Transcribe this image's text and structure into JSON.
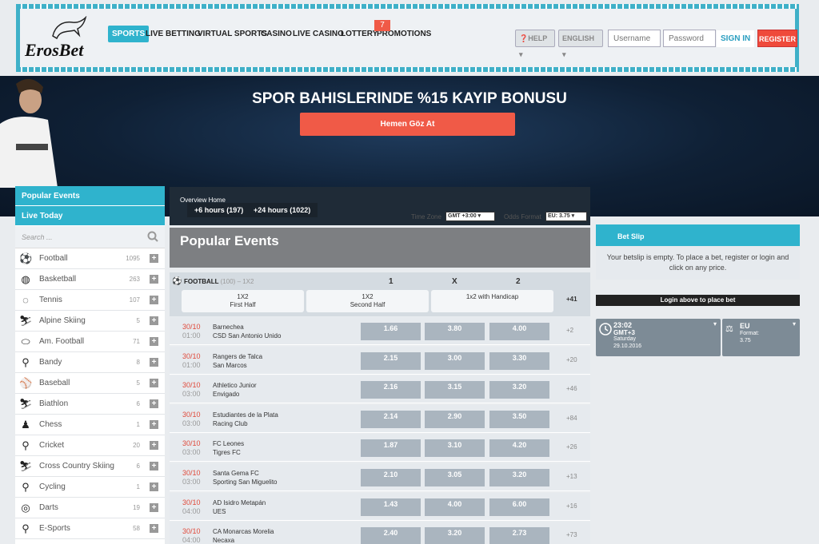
{
  "brand": {
    "name": "ErosBet"
  },
  "nav": [
    {
      "label": "SPORTS"
    },
    {
      "label": "LIVE BETTING"
    },
    {
      "label": "VIRTUAL SPORTS"
    },
    {
      "label": "CASINO"
    },
    {
      "label": "LIVE CASINO"
    },
    {
      "label": "LOTTERY"
    },
    {
      "label": "PROMOTIONS"
    }
  ],
  "promo_badge": "7",
  "header": {
    "help": "HELP",
    "language": "ENGLISH",
    "username_placeholder": "Username",
    "password_placeholder": "Password",
    "signin": "SIGN IN",
    "register": "REGISTER"
  },
  "hero": {
    "title": "SPOR BAHISLERINDE %15 KAYIP BONUSU",
    "button": "Hemen Göz At"
  },
  "left": {
    "popular": "Popular Events",
    "live_today": "Live Today",
    "search_placeholder": "Search ...",
    "sports": [
      {
        "name": "Football",
        "count": "1095",
        "icon": "soccer-ball-icon"
      },
      {
        "name": "Basketball",
        "count": "263",
        "icon": "basketball-icon"
      },
      {
        "name": "Tennis",
        "count": "107",
        "icon": "tennis-icon"
      },
      {
        "name": "Alpine Skiing",
        "count": "5",
        "icon": "skier-icon"
      },
      {
        "name": "Am. Football",
        "count": "71",
        "icon": "american-football-icon"
      },
      {
        "name": "Bandy",
        "count": "8",
        "icon": "bandy-icon"
      },
      {
        "name": "Baseball",
        "count": "5",
        "icon": "baseball-icon"
      },
      {
        "name": "Biathlon",
        "count": "6",
        "icon": "biathlon-icon"
      },
      {
        "name": "Chess",
        "count": "1",
        "icon": "chess-icon"
      },
      {
        "name": "Cricket",
        "count": "20",
        "icon": "cricket-icon"
      },
      {
        "name": "Cross Country Skiing",
        "count": "6",
        "icon": "cross-country-skiing-icon"
      },
      {
        "name": "Cycling",
        "count": "1",
        "icon": "cycling-icon"
      },
      {
        "name": "Darts",
        "count": "19",
        "icon": "darts-icon"
      },
      {
        "name": "E-Sports",
        "count": "58",
        "icon": "esports-icon"
      }
    ]
  },
  "overview": {
    "title": "Overview Home",
    "h6": "+6 hours (197)",
    "h24": "+24 hours (1022)",
    "timezone_label": "Time Zone",
    "timezone_value": "GMT +3:00",
    "odds_label": "Odds Format",
    "odds_value": "EU: 3.75"
  },
  "popular_title": "Popular Events",
  "table": {
    "sport": "FOOTBALL",
    "sport_count": "(100)",
    "sport_dash": "– 1X2",
    "col1": "1",
    "colx": "X",
    "col2": "2",
    "markets": [
      {
        "a": "1X2",
        "b": "First Half"
      },
      {
        "a": "1X2",
        "b": "Second Half"
      },
      {
        "a": "1x2 with Handicap",
        "b": ""
      }
    ],
    "more": "+41",
    "rows": [
      {
        "date": "30/10",
        "time": "01:00",
        "home": "Barnechea",
        "away": "CSD San Antonio Unido",
        "o1": "1.66",
        "ox": "3.80",
        "o2": "4.00",
        "more": "+2"
      },
      {
        "date": "30/10",
        "time": "01:00",
        "home": "Rangers de Talca",
        "away": "San Marcos",
        "o1": "2.15",
        "ox": "3.00",
        "o2": "3.30",
        "more": "+20"
      },
      {
        "date": "30/10",
        "time": "03:00",
        "home": "Athletico Junior",
        "away": "Envigado",
        "o1": "2.16",
        "ox": "3.15",
        "o2": "3.20",
        "more": "+46"
      },
      {
        "date": "30/10",
        "time": "03:00",
        "home": "Estudiantes de la Plata",
        "away": "Racing Club",
        "o1": "2.14",
        "ox": "2.90",
        "o2": "3.50",
        "more": "+84"
      },
      {
        "date": "30/10",
        "time": "03:00",
        "home": "FC Leones",
        "away": "Tigres FC",
        "o1": "1.87",
        "ox": "3.10",
        "o2": "4.20",
        "more": "+26"
      },
      {
        "date": "30/10",
        "time": "03:00",
        "home": "Santa Gema FC",
        "away": "Sporting San Miguelito",
        "o1": "2.10",
        "ox": "3.05",
        "o2": "3.20",
        "more": "+13"
      },
      {
        "date": "30/10",
        "time": "04:00",
        "home": "AD Isidro Metapán",
        "away": "UES",
        "o1": "1.43",
        "ox": "4.00",
        "o2": "6.00",
        "more": "+16"
      },
      {
        "date": "30/10",
        "time": "04:00",
        "home": "CA Monarcas Morelia",
        "away": "Necaxa",
        "o1": "2.40",
        "ox": "3.20",
        "o2": "2.73",
        "more": "+73"
      }
    ]
  },
  "betslip": {
    "title": "Bet Slip",
    "empty": "Your betslip is empty. To place a bet, register or login and click on any price.",
    "login": "Login above to place bet"
  },
  "clock": {
    "time": "23:02",
    "tz": "GMT+3",
    "day": "Saturday",
    "date": "29.10.2016"
  },
  "format": {
    "value": "EU",
    "label": "Format:",
    "num": "3.75"
  }
}
